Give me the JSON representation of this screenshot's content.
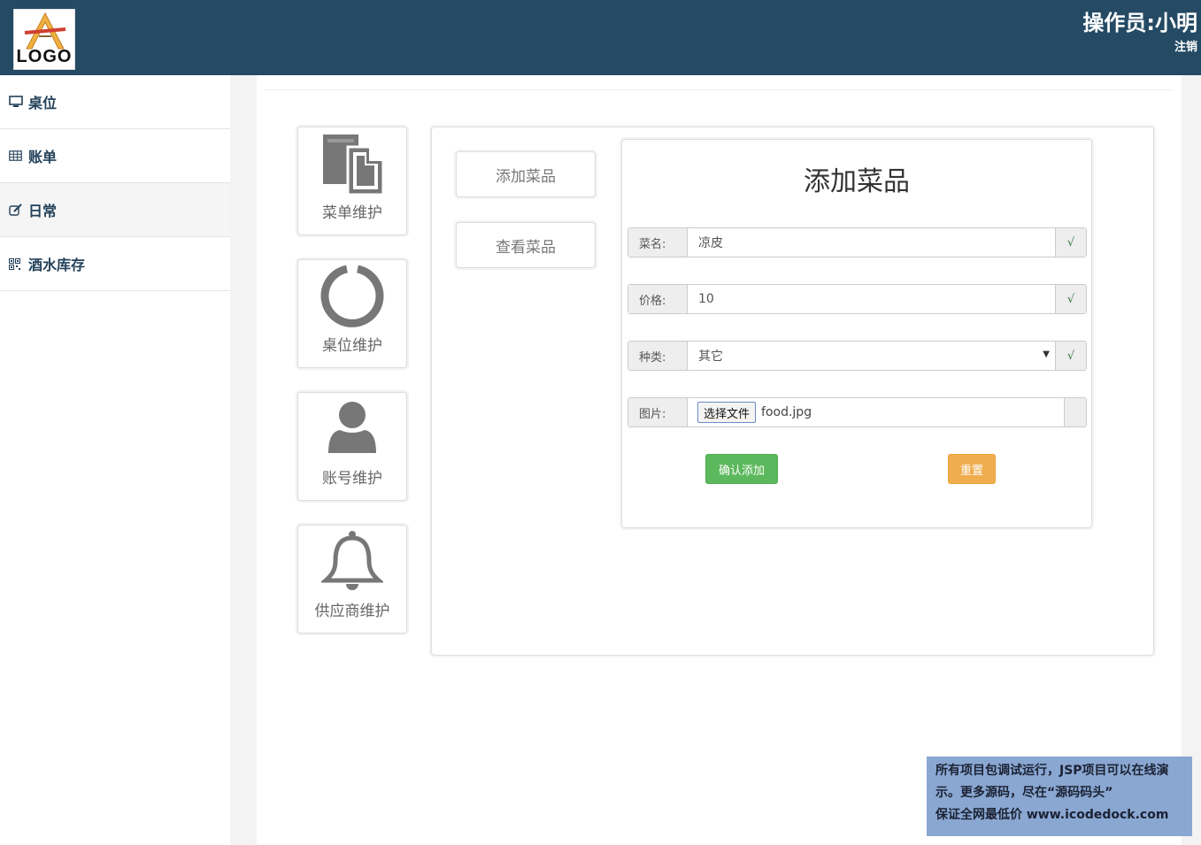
{
  "header": {
    "logo_text": "LOGO",
    "operator": "操作员:小明",
    "logout": "注销"
  },
  "sidebar": {
    "items": [
      {
        "label": "桌位",
        "icon": "monitor-icon"
      },
      {
        "label": "账单",
        "icon": "table-icon"
      },
      {
        "label": "日常",
        "icon": "edit-icon"
      },
      {
        "label": "酒水库存",
        "icon": "qrcode-icon"
      }
    ]
  },
  "tiles": [
    {
      "label": "菜单维护",
      "icon": "document-icon"
    },
    {
      "label": "桌位维护",
      "icon": "ring-icon"
    },
    {
      "label": "账号维护",
      "icon": "user-icon"
    },
    {
      "label": "供应商维护",
      "icon": "bell-icon"
    }
  ],
  "subnav": {
    "add": "添加菜品",
    "view": "查看菜品"
  },
  "form": {
    "title": "添加菜品",
    "name_label": "菜名:",
    "name_value": "凉皮",
    "price_label": "价格:",
    "price_value": "10",
    "category_label": "种类:",
    "category_value": "其它",
    "image_label": "图片:",
    "file_button": "选择文件",
    "file_name": "food.jpg",
    "check_mark": "√",
    "submit": "确认添加",
    "reset": "重置"
  },
  "watermark": {
    "line1": "所有项目包调试运行，JSP项目可以在线演",
    "line2": "示。更多源码，尽在“源码码头”",
    "line3": "保证全网最低价 www.icodedock.com"
  },
  "colors": {
    "header_bg": "#244a64",
    "success": "#5cb85c",
    "warning": "#f0ad4e",
    "watermark_bg": "#8aa7d2"
  }
}
